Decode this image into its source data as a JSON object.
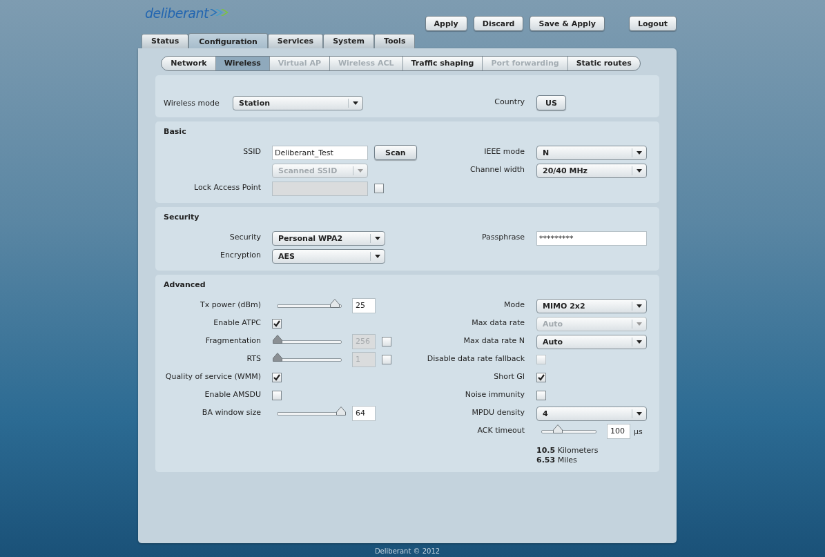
{
  "logo": "deliberant",
  "actions": [
    "Apply",
    "Discard",
    "Save & Apply"
  ],
  "logout": "Logout",
  "tabs": [
    {
      "label": "Status",
      "selected": false
    },
    {
      "label": "Configuration",
      "selected": true
    },
    {
      "label": "Services",
      "selected": false
    },
    {
      "label": "System",
      "selected": false
    },
    {
      "label": "Tools",
      "selected": false
    }
  ],
  "subtabs": [
    {
      "label": "Network",
      "selected": false,
      "disabled": false
    },
    {
      "label": "Wireless",
      "selected": true,
      "disabled": false
    },
    {
      "label": "Virtual AP",
      "selected": false,
      "disabled": true
    },
    {
      "label": "Wireless ACL",
      "selected": false,
      "disabled": true
    },
    {
      "label": "Traffic shaping",
      "selected": false,
      "disabled": false
    },
    {
      "label": "Port forwarding",
      "selected": false,
      "disabled": true
    },
    {
      "label": "Static routes",
      "selected": false,
      "disabled": false
    }
  ],
  "mode_bar": {
    "wireless_mode": {
      "label": "Wireless mode",
      "value": "Station"
    },
    "country": {
      "label": "Country",
      "value": "US"
    }
  },
  "sections": [
    {
      "title": "Basic",
      "columns": [
        {
          "rows": [
            {
              "kind": "text",
              "label": "SSID",
              "value": "Deliberant_Test",
              "button": "Scan"
            },
            {
              "kind": "select",
              "value": "Scanned SSID",
              "disabled": true
            },
            {
              "kind": "text-check",
              "label": "Lock Access Point",
              "disabled": true,
              "checked": false
            }
          ]
        },
        {
          "rows": [
            {
              "kind": "select",
              "label": "IEEE mode",
              "value": "N",
              "disabled": false
            },
            {
              "kind": "select",
              "label": "Channel width",
              "value": "20/40 MHz",
              "disabled": false
            }
          ]
        }
      ]
    },
    {
      "title": "Security",
      "columns": [
        {
          "rows": [
            {
              "kind": "select",
              "label": "Security",
              "value": "Personal WPA2",
              "disabled": false
            },
            {
              "kind": "select",
              "label": "Encryption",
              "value": "AES",
              "disabled": false
            }
          ]
        },
        {
          "rows": [
            {
              "kind": "text",
              "label": "Passphrase",
              "value": "*********"
            }
          ]
        }
      ]
    },
    {
      "title": "Advanced",
      "columns": [
        {
          "rows": [
            {
              "kind": "slider",
              "label": "Tx power (dBm)",
              "level": 0.9,
              "value": "25",
              "disabled": false
            },
            {
              "kind": "checkbox",
              "label": "Enable ATPC",
              "checked": true,
              "disabled": false
            },
            {
              "kind": "slider",
              "label": "Fragmentation",
              "level": 0,
              "value": "256",
              "disabled": true,
              "checked": false
            },
            {
              "kind": "slider",
              "label": "RTS",
              "level": 0,
              "value": "1",
              "disabled": true,
              "checked": false
            },
            {
              "kind": "checkbox",
              "label": "Quality of service (WMM)",
              "checked": true,
              "disabled": false
            },
            {
              "kind": "checkbox",
              "label": "Enable AMSDU",
              "checked": false,
              "disabled": false
            },
            {
              "kind": "slider",
              "label": "BA window size",
              "level": 1,
              "value": "64",
              "disabled": false
            }
          ]
        },
        {
          "rows": [
            {
              "kind": "select",
              "label": "Mode",
              "value": "MIMO 2x2",
              "disabled": false
            },
            {
              "kind": "select",
              "label": "Max data rate",
              "value": "Auto",
              "disabled": true
            },
            {
              "kind": "select",
              "label": "Max data rate N",
              "value": "Auto",
              "disabled": false
            },
            {
              "kind": "checkbox",
              "label": "Disable data rate fallback",
              "checked": false,
              "disabled": true
            },
            {
              "kind": "checkbox",
              "label": "Short GI",
              "checked": true,
              "disabled": false
            },
            {
              "kind": "checkbox",
              "label": "Noise immunity",
              "checked": false,
              "disabled": false
            },
            {
              "kind": "select",
              "label": "MPDU density",
              "value": "4",
              "disabled": false
            },
            {
              "kind": "slider",
              "label": "ACK timeout",
              "level": 0.3,
              "value": "100",
              "disabled": false,
              "unit": "µs",
              "notes": [
                "**10.5** Kilometers",
                "**6.53** Miles"
              ]
            }
          ]
        }
      ]
    }
  ],
  "footer": "Deliberant © 2012"
}
